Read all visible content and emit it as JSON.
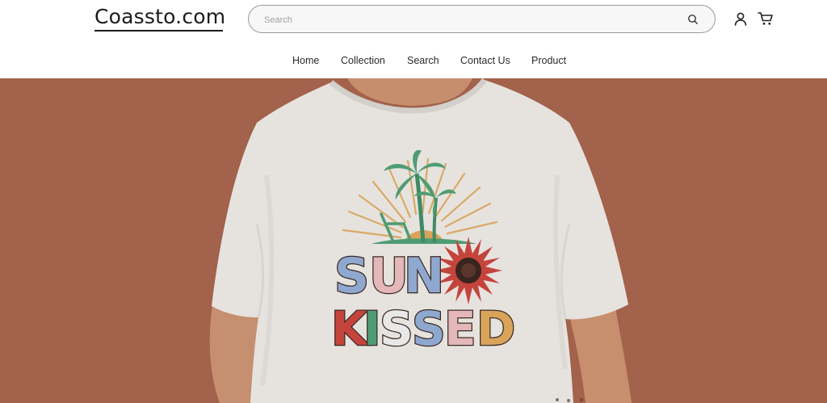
{
  "header": {
    "logo_text": "Coassto.com",
    "search": {
      "placeholder": "Search",
      "value": ""
    },
    "icons": [
      "search-icon",
      "account-icon",
      "cart-icon"
    ]
  },
  "nav": {
    "items": [
      {
        "label": "Home"
      },
      {
        "label": "Collection"
      },
      {
        "label": "Search"
      },
      {
        "label": "Contact Us"
      },
      {
        "label": "Product"
      }
    ]
  },
  "hero": {
    "background_color": "#a2624b",
    "shirt_color": "#e6e3df",
    "print_text_line1": "SUN",
    "print_text_line2": "KISSED"
  }
}
